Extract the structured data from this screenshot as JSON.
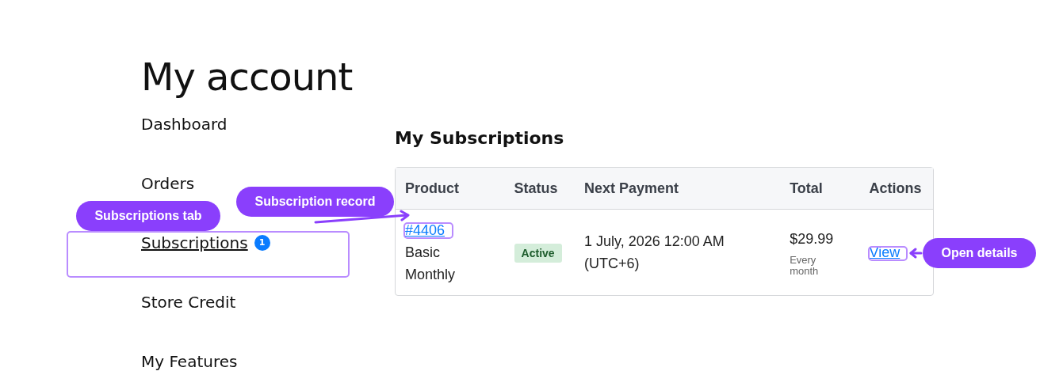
{
  "page_title": "My account",
  "nav": [
    {
      "label": "Dashboard",
      "selected": false
    },
    {
      "label": "Orders",
      "selected": false
    },
    {
      "label": "Subscriptions",
      "selected": true,
      "badge": "1"
    },
    {
      "label": "Store Credit",
      "selected": false
    },
    {
      "label": "My Features",
      "selected": false
    }
  ],
  "section_title": "My Subscriptions",
  "table": {
    "columns": [
      "Product",
      "Status",
      "Next Payment",
      "Total",
      "Actions"
    ],
    "rows": [
      {
        "number": "#4406",
        "product": "Basic Monthly",
        "status": "Active",
        "next_payment": "1 July, 2026 12:00 AM (UTC+6)",
        "total": "$29.99",
        "period": "Every month",
        "action": "View"
      }
    ]
  },
  "annotations": [
    {
      "label": "Subscriptions tab"
    },
    {
      "label": "Subscription record"
    },
    {
      "label": "Open details"
    }
  ]
}
